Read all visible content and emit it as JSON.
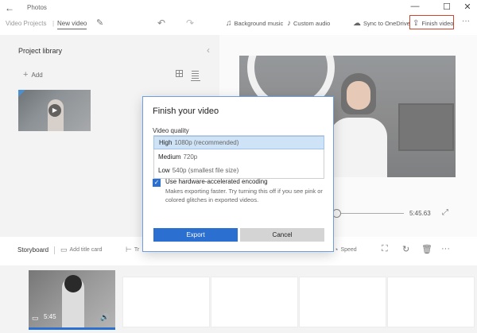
{
  "window": {
    "back_icon": "←",
    "app_title": "Photos",
    "minimize": "—",
    "maximize": "☐",
    "close": "✕"
  },
  "toolbar": {
    "breadcrumb_root": "Video Projects",
    "breadcrumb_sep": "|",
    "breadcrumb_current": "New video",
    "rename_icon": "✎",
    "undo_icon": "↶",
    "redo_icon": "↷",
    "background_music_icon": "♫",
    "background_music": "Background music",
    "custom_audio_icon": "♪",
    "custom_audio": "Custom audio",
    "sync_icon": "☁",
    "sync_onedrive": "Sync to OneDrive",
    "finish_icon": "⇪",
    "finish_video": "Finish video",
    "more_icon": "···"
  },
  "library": {
    "title": "Project library",
    "collapse_icon": "‹",
    "add_icon": "+",
    "add_label": "Add",
    "play_icon": "▶"
  },
  "preview": {
    "duration": "5:45.63",
    "expand_icon": "⤢"
  },
  "storyboard": {
    "title": "Storyboard",
    "add_title_card_icon": "▭",
    "add_title_card": "Add title card",
    "trim_icon": "⊢",
    "trim": "Tr",
    "speed_icon": "◔",
    "speed": "Speed",
    "crop_icon": "⛶",
    "rotate_icon": "↻",
    "delete_icon": "🗑",
    "more_icon": "···",
    "clip_type_icon": "▭",
    "clip_duration": "5:45",
    "clip_volume_icon": "🔊"
  },
  "dialog": {
    "title": "Finish your video",
    "quality_label": "Video quality",
    "options": [
      {
        "main": "High",
        "sub": "1080p (recommended)"
      },
      {
        "main": "Medium",
        "sub": "720p"
      },
      {
        "main": "Low",
        "sub": "540p (smallest file size)"
      }
    ],
    "selected_option": "High",
    "hw_checked": true,
    "hw_check_icon": "✓",
    "hw_label": "Use hardware-accelerated encoding",
    "hw_desc": "Makes exporting faster. Try turning this off if you see pink or colored glitches in exported videos.",
    "export": "Export",
    "cancel": "Cancel"
  },
  "colors": {
    "accent": "#2b6fd1",
    "finish_highlight": "#d0452b",
    "selection": "#cfe3f7"
  }
}
